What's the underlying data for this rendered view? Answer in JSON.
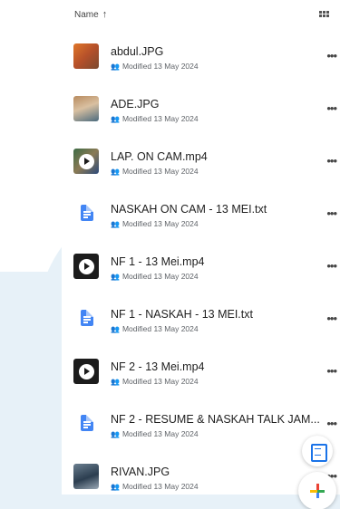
{
  "header": {
    "sort_label": "Name",
    "sort_icon": "arrow-up-icon",
    "view_icon": "grid-view-icon"
  },
  "files": [
    {
      "name": "abdul.JPG",
      "modified": "Modified 13 May 2024",
      "type": "photo1"
    },
    {
      "name": "ADE.JPG",
      "modified": "Modified 13 May 2024",
      "type": "photo2"
    },
    {
      "name": "LAP. ON CAM.mp4",
      "modified": "Modified 13 May 2024",
      "type": "video-photo"
    },
    {
      "name": "NASKAH ON CAM - 13 MEI.txt",
      "modified": "Modified 13 May 2024",
      "type": "doc"
    },
    {
      "name": "NF 1 - 13 Mei.mp4",
      "modified": "Modified 13 May 2024",
      "type": "video"
    },
    {
      "name": "NF 1 - NASKAH - 13 MEI.txt",
      "modified": "Modified 13 May 2024",
      "type": "doc"
    },
    {
      "name": "NF 2 - 13 Mei.mp4",
      "modified": "Modified 13 May 2024",
      "type": "video"
    },
    {
      "name": "NF 2 - RESUME & NASKAH TALK JAM...",
      "modified": "Modified 13 May 2024",
      "type": "doc"
    },
    {
      "name": "RIVAN.JPG",
      "modified": "Modified 13 May 2024",
      "type": "photo3"
    }
  ],
  "fabs": {
    "scan_icon": "scan-document-icon",
    "new_icon": "plus-icon"
  },
  "colors": {
    "accent": "#1a73e8",
    "doc_blue": "#4285f4",
    "plus_red": "#ea4335",
    "plus_yellow": "#fbbc04",
    "plus_green": "#34a853"
  },
  "more_glyph": "•••",
  "shared_glyph": "👥"
}
